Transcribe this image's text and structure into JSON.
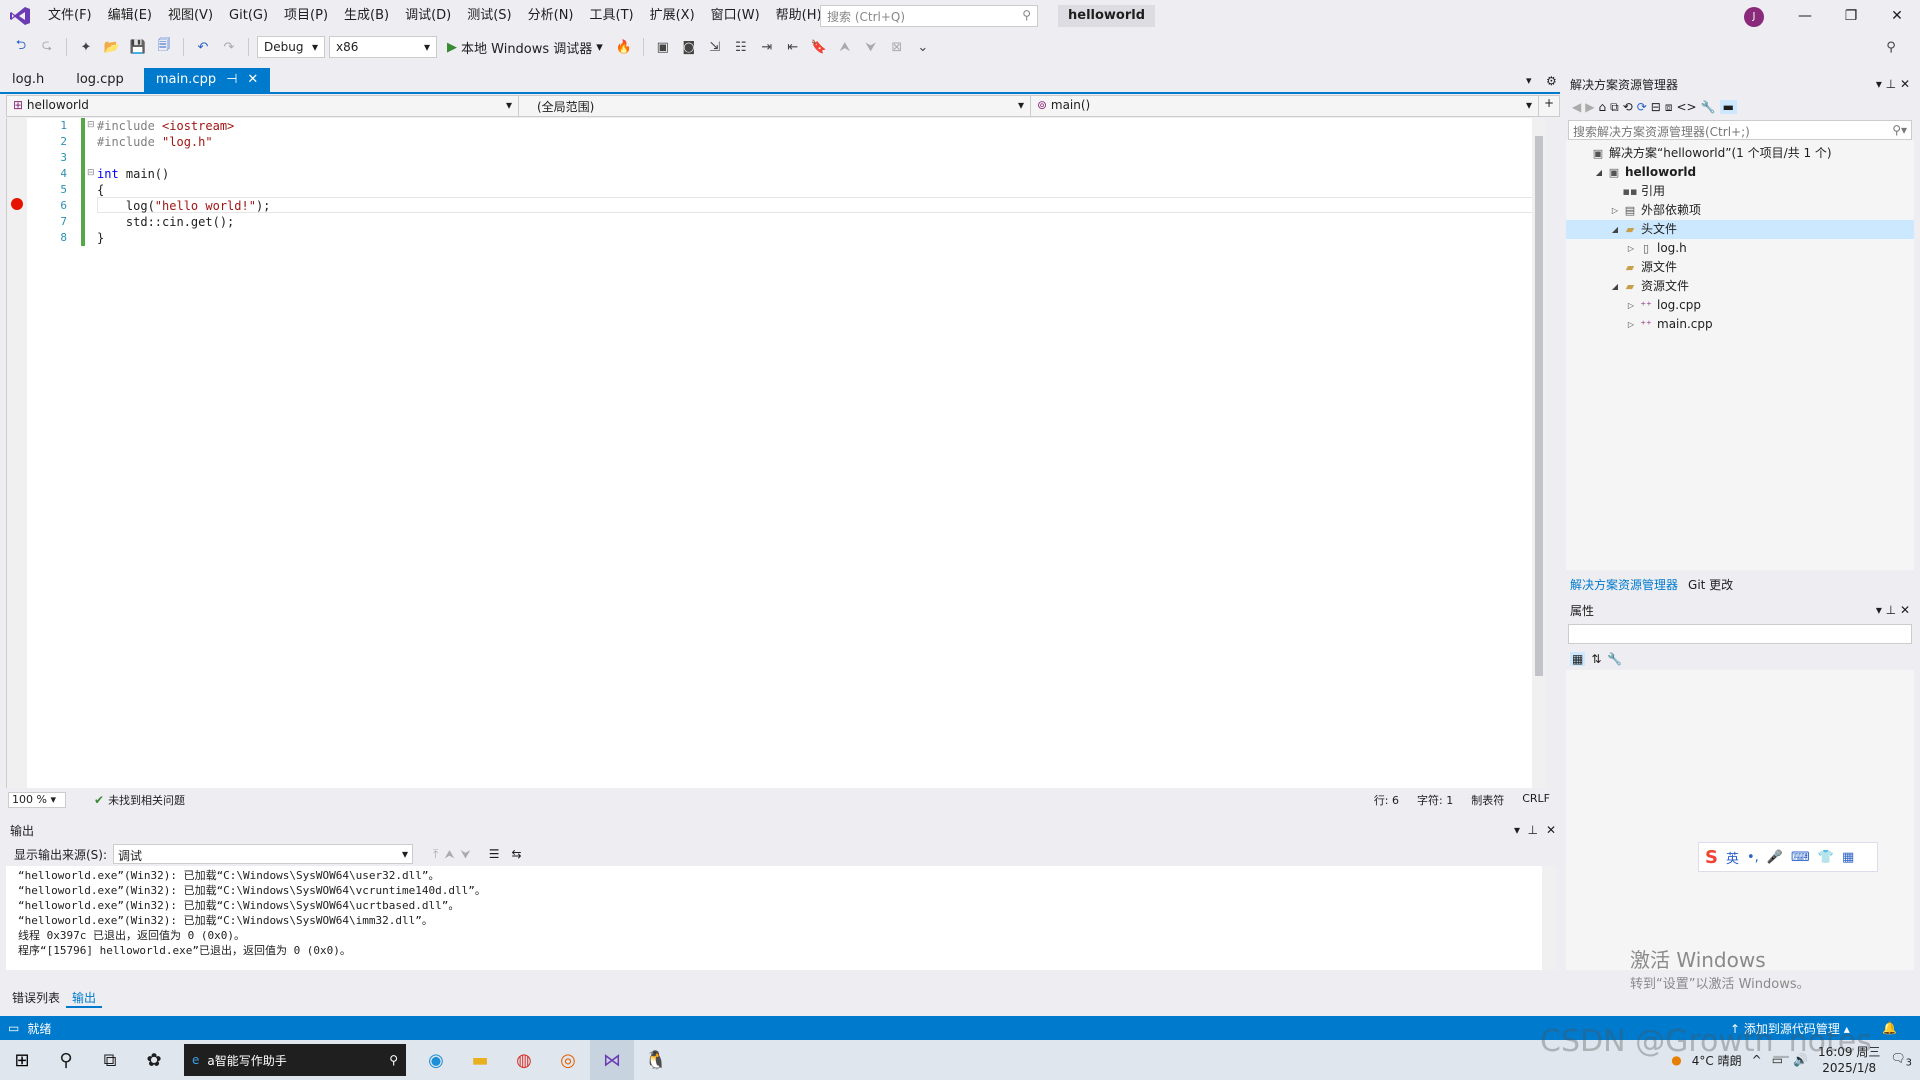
{
  "menubar": {
    "items": [
      "文件(F)",
      "编辑(E)",
      "视图(V)",
      "Git(G)",
      "项目(P)",
      "生成(B)",
      "调试(D)",
      "测试(S)",
      "分析(N)",
      "工具(T)",
      "扩展(X)",
      "窗口(W)",
      "帮助(H)"
    ],
    "search_placeholder": "搜索 (Ctrl+Q)",
    "solution_title": "helloworld",
    "avatar_initial": "J"
  },
  "toolbar": {
    "config": "Debug",
    "platform": "x86",
    "run_label": "本地 Windows 调试器"
  },
  "doc_tabs": [
    {
      "label": "log.h"
    },
    {
      "label": "log.cpp"
    },
    {
      "label": "main.cpp",
      "active": true
    }
  ],
  "navbar": {
    "project": "helloworld",
    "scope": "(全局范围)",
    "member": "main()"
  },
  "editor": {
    "line_numbers": [
      "1",
      "2",
      "3",
      "4",
      "5",
      "6",
      "7",
      "8"
    ],
    "lines": [
      [
        {
          "t": "#include ",
          "c": "pp"
        },
        {
          "t": "<iostream>",
          "c": "str"
        }
      ],
      [
        {
          "t": "#include ",
          "c": "pp"
        },
        {
          "t": "\"log.h\"",
          "c": "str"
        }
      ],
      [
        {
          "t": "",
          "c": ""
        }
      ],
      [
        {
          "t": "int",
          "c": "kw"
        },
        {
          "t": " main()",
          "c": ""
        }
      ],
      [
        {
          "t": "{",
          "c": ""
        }
      ],
      [
        {
          "t": "    log(",
          "c": ""
        },
        {
          "t": "\"hello world!\"",
          "c": "str"
        },
        {
          "t": ");",
          "c": ""
        }
      ],
      [
        {
          "t": "    std::cin.get();",
          "c": ""
        }
      ],
      [
        {
          "t": "}",
          "c": ""
        }
      ]
    ],
    "breakpoint_line": 6
  },
  "editor_status": {
    "zoom": "100 %",
    "issues": "未找到相关问题",
    "line": "行: 6",
    "col": "字符: 1",
    "tabs": "制表符",
    "eol": "CRLF"
  },
  "output": {
    "title": "输出",
    "source_label": "显示输出来源(S):",
    "source_value": "调试",
    "lines": [
      "“helloworld.exe”(Win32): 已加载“C:\\Windows\\SysWOW64\\user32.dll”。",
      "“helloworld.exe”(Win32): 已加载“C:\\Windows\\SysWOW64\\vcruntime140d.dll”。",
      "“helloworld.exe”(Win32): 已加载“C:\\Windows\\SysWOW64\\ucrtbased.dll”。",
      "“helloworld.exe”(Win32): 已加载“C:\\Windows\\SysWOW64\\imm32.dll”。",
      "线程 0x397c 已退出，返回值为 0 (0x0)。",
      "程序“[15796] helloworld.exe”已退出，返回值为 0 (0x0)。"
    ]
  },
  "bottom_tabs": [
    "错误列表",
    "输出"
  ],
  "solution_explorer": {
    "title": "解决方案资源管理器",
    "search_placeholder": "搜索解决方案资源管理器(Ctrl+;)",
    "tree": [
      {
        "label": "解决方案“helloworld”(1 个项目/共 1 个)",
        "indent": 0,
        "twisty": "",
        "icon": "solution-icon"
      },
      {
        "label": "helloworld",
        "indent": 1,
        "twisty": "◢",
        "icon": "project-icon",
        "bold": true
      },
      {
        "label": "引用",
        "indent": 2,
        "twisty": "",
        "icon": "references-icon"
      },
      {
        "label": "外部依赖项",
        "indent": 2,
        "twisty": "▷",
        "icon": "external-deps-icon"
      },
      {
        "label": "头文件",
        "indent": 2,
        "twisty": "◢",
        "icon": "filter-folder-icon",
        "selected": true
      },
      {
        "label": "log.h",
        "indent": 3,
        "twisty": "▷",
        "icon": "header-file-icon"
      },
      {
        "label": "源文件",
        "indent": 2,
        "twisty": "",
        "icon": "filter-folder-icon"
      },
      {
        "label": "资源文件",
        "indent": 2,
        "twisty": "◢",
        "icon": "filter-folder-icon"
      },
      {
        "label": "log.cpp",
        "indent": 3,
        "twisty": "▷",
        "icon": "cpp-file-icon"
      },
      {
        "label": "main.cpp",
        "indent": 3,
        "twisty": "▷",
        "icon": "cpp-file-icon"
      }
    ],
    "tabs": [
      "解决方案资源管理器",
      "Git 更改"
    ]
  },
  "properties": {
    "title": "属性"
  },
  "activation": {
    "line1": "激活 Windows",
    "line2": "转到“设置”以激活 Windows。"
  },
  "ime": {
    "mode": "英"
  },
  "statusbar": {
    "ready": "就绪",
    "source_control": "添加到源代码管理"
  },
  "taskbar": {
    "search_text": "a智能写作助手",
    "weather": "4°C  晴朗",
    "time": "16:09 周三",
    "date": "2025/1/8",
    "notif_count": "3"
  },
  "watermark": "CSDN @Growth_notes"
}
